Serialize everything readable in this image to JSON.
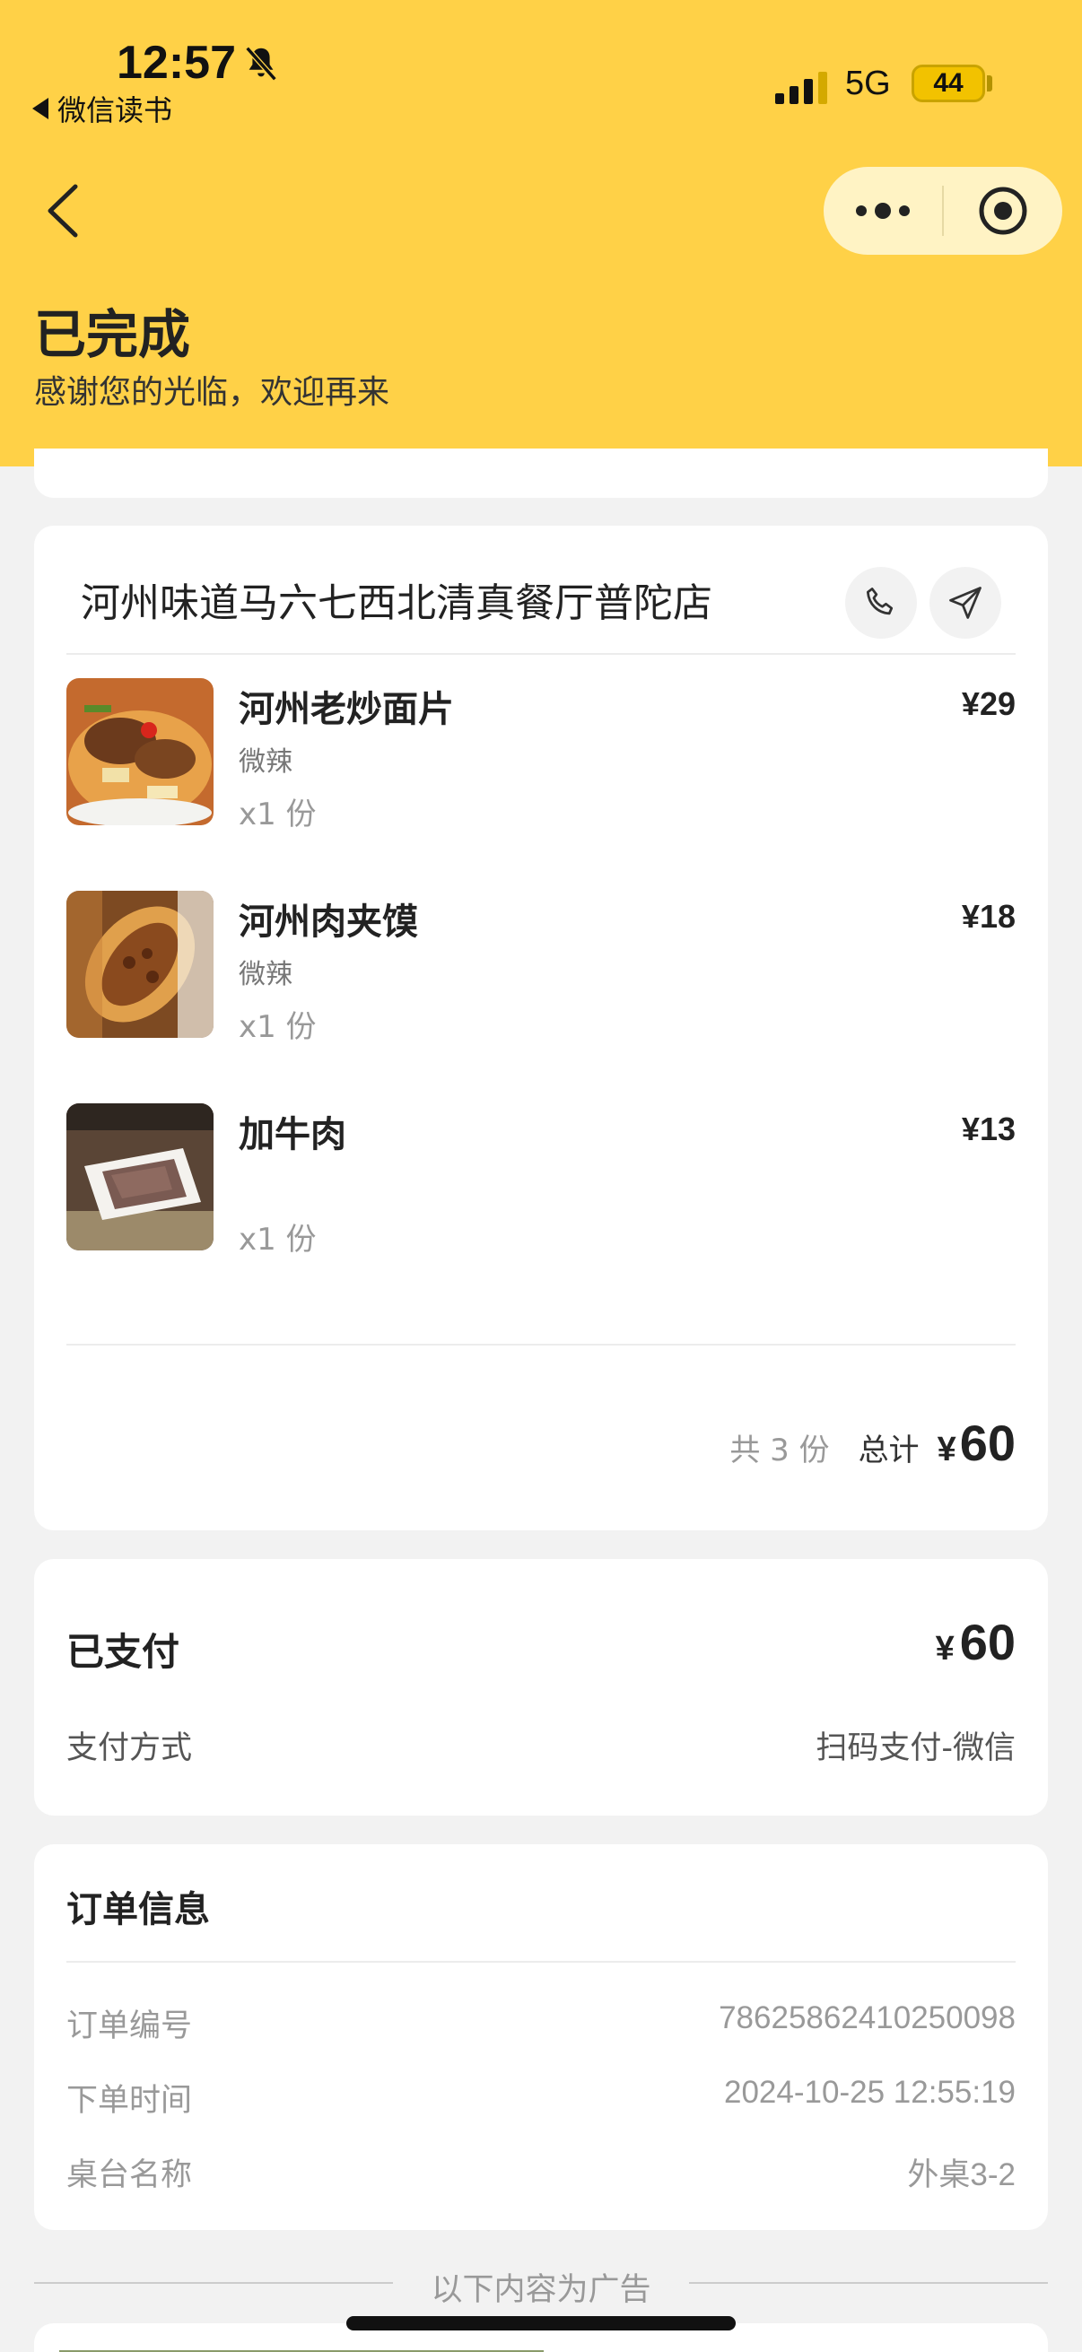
{
  "status_bar": {
    "time": "12:57",
    "back_app": "微信读书",
    "network": "5G",
    "battery": "44"
  },
  "header": {
    "title": "已完成",
    "subtitle": "感谢您的光临，欢迎再来"
  },
  "order": {
    "store_name": "河州味道马六七西北清真餐厅普陀店",
    "items": [
      {
        "name": "河州老炒面片",
        "spec": "微辣",
        "qty": "x1 份",
        "price": "¥29"
      },
      {
        "name": "河州肉夹馍",
        "spec": "微辣",
        "qty": "x1 份",
        "price": "¥18"
      },
      {
        "name": "加牛肉",
        "spec": "",
        "qty": "x1 份",
        "price": "¥13"
      }
    ],
    "summary": {
      "count": "共 3 份",
      "total_label": "总计",
      "currency": "¥",
      "total": "60"
    }
  },
  "payment": {
    "label": "已支付",
    "currency": "¥",
    "amount": "60",
    "method_label": "支付方式",
    "method_value": "扫码支付-微信"
  },
  "order_info": {
    "title": "订单信息",
    "rows": [
      {
        "key": "订单编号",
        "value": "78625862410250098"
      },
      {
        "key": "下单时间",
        "value": "2024-10-25 12:55:19"
      },
      {
        "key": "桌台名称",
        "value": "外桌3-2"
      }
    ]
  },
  "ad": {
    "label": "以下内容为广告"
  },
  "colors": {
    "header_bg": "#ffd147",
    "capsule_bg": "#fff3c4",
    "page_bg": "#f2f2f2"
  }
}
